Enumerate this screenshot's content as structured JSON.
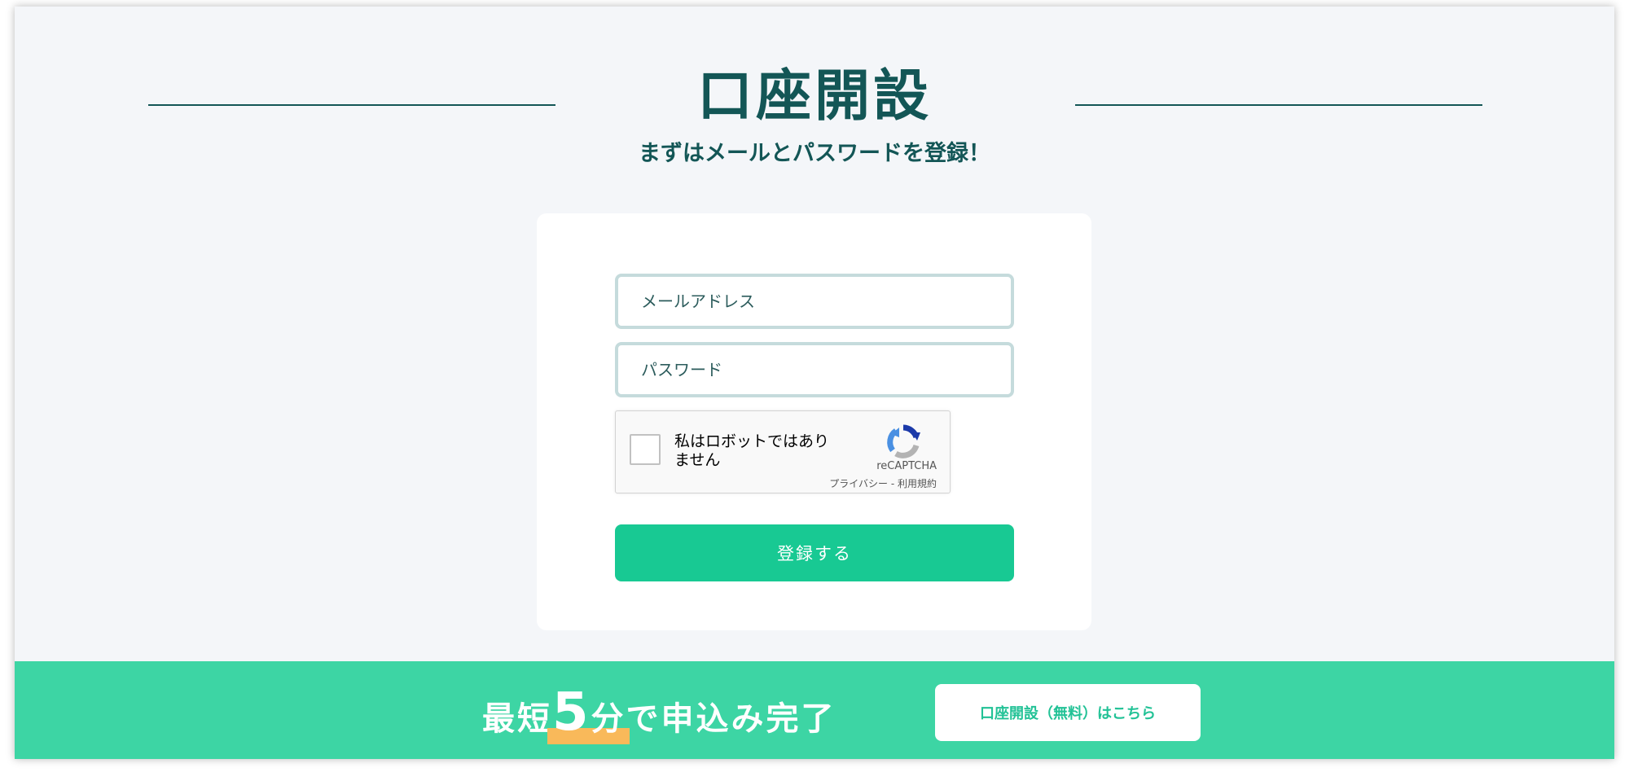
{
  "header": {
    "title": "口座開設",
    "subtitle": "まずはメールとパスワードを登録！"
  },
  "form": {
    "email_placeholder": "メールアドレス",
    "email_value": "",
    "password_placeholder": "パスワード",
    "password_value": "",
    "submit_label": "登録する"
  },
  "recaptcha": {
    "label": "私はロボットではありません",
    "brand": "reCAPTCHA",
    "privacy": "プライバシー",
    "separator": " - ",
    "terms": "利用規約",
    "checked": false,
    "logo_icon": "recaptcha-logo-icon"
  },
  "banner": {
    "tagline_prefix": "最短",
    "tagline_number": "5",
    "tagline_unit": "分",
    "tagline_suffix": "で申込み完了",
    "cta_label": "口座開設（無料）はこちら",
    "highlight_color": "#f9b95a",
    "background_color": "#3dd5a4"
  },
  "colors": {
    "heading": "#135656",
    "button": "#18c993",
    "page_background": "#f4f6f9"
  }
}
